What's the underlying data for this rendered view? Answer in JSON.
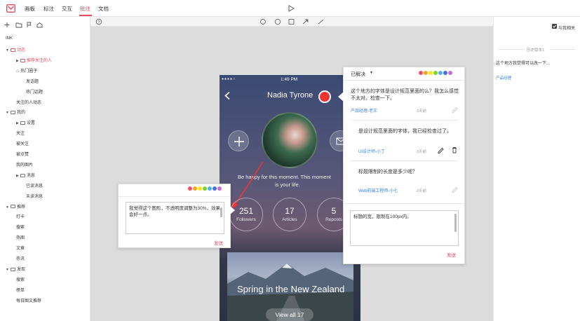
{
  "menu": [
    "画板",
    "标注",
    "交互",
    "批注",
    "文档"
  ],
  "active_menu_index": 3,
  "colors": {
    "accent": "#e84b64",
    "link": "#3b7ddd"
  },
  "sidebar": {
    "root": "INK",
    "items": [
      {
        "label": "动态",
        "level": 0,
        "folder": true,
        "active": true
      },
      {
        "label": "推荐关注的人",
        "level": 1,
        "folder": true,
        "active": true
      },
      {
        "label": "热门圈子",
        "level": 1,
        "icon": "home-icon"
      },
      {
        "label": "发话题",
        "level": 2
      },
      {
        "label": "热门话题",
        "level": 2
      },
      {
        "label": "关注的人动态",
        "level": 1
      },
      {
        "label": "我的",
        "level": 0,
        "folder": true
      },
      {
        "label": "设置",
        "level": 1,
        "folder": true
      },
      {
        "label": "关注",
        "level": 1
      },
      {
        "label": "被关注",
        "level": 1
      },
      {
        "label": "被点赞",
        "level": 1
      },
      {
        "label": "我的图片",
        "level": 1
      },
      {
        "label": "消息",
        "level": 1,
        "folder": true
      },
      {
        "label": "已读消息",
        "level": 2
      },
      {
        "label": "未读消息",
        "level": 2
      },
      {
        "label": "推荐",
        "level": 0,
        "folder": true
      },
      {
        "label": "打卡",
        "level": 1
      },
      {
        "label": "搜索",
        "level": 1
      },
      {
        "label": "热图",
        "level": 1
      },
      {
        "label": "文章",
        "level": 1
      },
      {
        "label": "热讯",
        "level": 1
      },
      {
        "label": "发现",
        "level": 0,
        "folder": true
      },
      {
        "label": "搜索",
        "level": 1
      },
      {
        "label": "榜单",
        "level": 1
      },
      {
        "label": "每日图文推荐",
        "level": 1
      }
    ]
  },
  "right_panel": {
    "checkbox_label": "与我相关",
    "history_label": "历史版本1",
    "history_text": "这个地方我觉得可以改一下...",
    "history_author": "产品经理"
  },
  "phone": {
    "time": "1:49 PM",
    "name": "Nadia Tyrone",
    "tagline_1": "Be happy for this moment. This moment",
    "tagline_2": "is your life.",
    "stats": [
      {
        "value": "251",
        "label": "Followers"
      },
      {
        "value": "17",
        "label": "Articles"
      },
      {
        "value": "5",
        "label": "Reposts"
      }
    ],
    "card_title": "Spring in the New Zealand",
    "card_button": "View all 17"
  },
  "popup_left": {
    "text": "我觉得这个图形，不透明度调整为30%，效果会好一点。",
    "send": "发送",
    "dots": [
      "#f0506e",
      "#f5a623",
      "#f8e71c",
      "#7ed321",
      "#50b3e8",
      "#4a6fe3",
      "#c86dd7"
    ]
  },
  "popup_right": {
    "status": "已解决",
    "dots": [
      "#f0506e",
      "#f5a623",
      "#f8e71c",
      "#7ed321",
      "#50b3e8",
      "#4a6fe3",
      "#c86dd7"
    ],
    "comments": [
      {
        "text": "这个地方的字体是设计规范里面的么？我怎么感觉不太对。检查一下。",
        "author": "产品经理-老王",
        "time": "3天前"
      },
      {
        "text": "是设计规范里面的字体，我已经检查过了。",
        "author": "UI设计师-小丁",
        "time": "3天前"
      },
      {
        "text": "标题限制的长度是多少呢？",
        "author": "Web前端工程师-小七",
        "time": "2天前"
      }
    ],
    "reply_text": "标题的宽，限制在100px内。",
    "send": "发送"
  }
}
